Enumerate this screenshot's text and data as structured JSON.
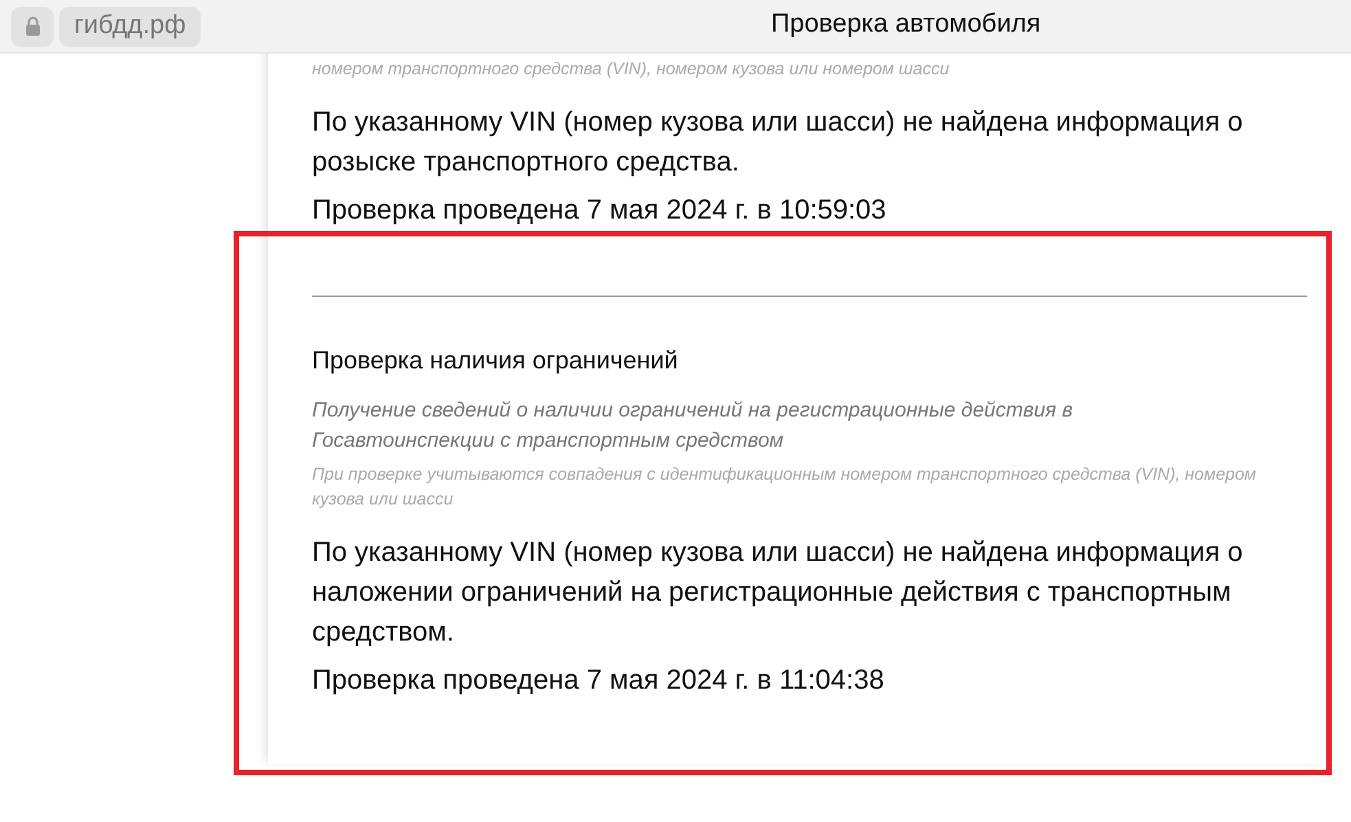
{
  "address_bar": {
    "domain": "гибдд.рф",
    "title": "Проверка автомобиля"
  },
  "sections": [
    {
      "note": "номером транспортного средства (VIN), номером кузова или номером шасси",
      "result": "По указанному VIN (номер кузова или шасси) не найдена информация о розыске транспортного средства.",
      "checked_at": "Проверка проведена 7 мая 2024 г. в 10:59:03"
    },
    {
      "title": "Проверка наличия ограничений",
      "description": "Получение сведений о наличии ограничений на регистрационные действия в Госавтоинспекции с транспортным средством",
      "note": "При проверке учитываются совпадения с идентификационным номером транспортного средства (VIN), номером кузова или шасси",
      "result": "По указанному VIN (номер кузова или шасси) не найдена информация о наложении ограничений на регистрационные действия с транспортным средством.",
      "checked_at": "Проверка проведена 7 мая 2024 г. в 11:04:38"
    }
  ]
}
